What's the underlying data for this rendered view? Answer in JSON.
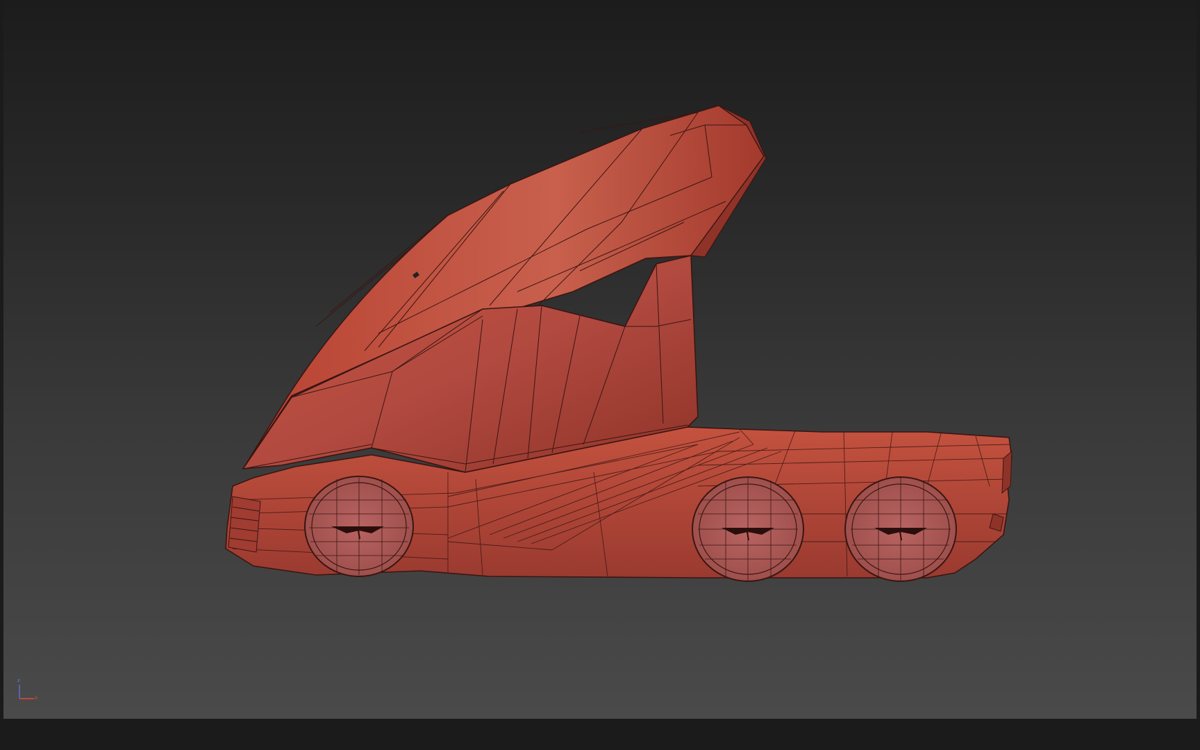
{
  "viewport": {
    "background_top": "#1c1c1c",
    "background_bottom": "#4a4a4a",
    "model_color": "#b8473b",
    "wire_color": "#3a1512"
  },
  "gizmo": {
    "axis_z_label": "z",
    "axis_x_label": "x",
    "axis_z_color": "#5a6fe0",
    "axis_x_color": "#e04a3a"
  }
}
